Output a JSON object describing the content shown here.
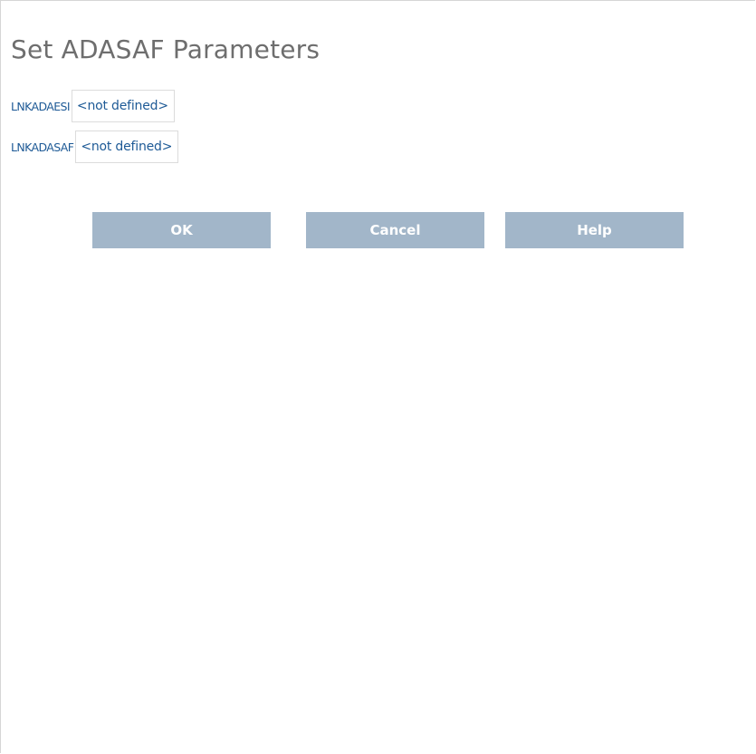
{
  "page": {
    "title": "Set ADASAF Parameters"
  },
  "parameters": [
    {
      "label": "LNKADAESI",
      "value": "<not defined>"
    },
    {
      "label": "LNKADASAF",
      "value": "<not defined>"
    }
  ],
  "buttons": {
    "ok_label": "OK",
    "cancel_label": "Cancel",
    "help_label": "Help"
  },
  "colors": {
    "title": "#6e6e6e",
    "label": "#1e5a96",
    "button_background": "#a2b6c9",
    "button_text": "#ffffff",
    "field_border": "#dcdcdc",
    "frame_border": "#d6d6d6"
  }
}
